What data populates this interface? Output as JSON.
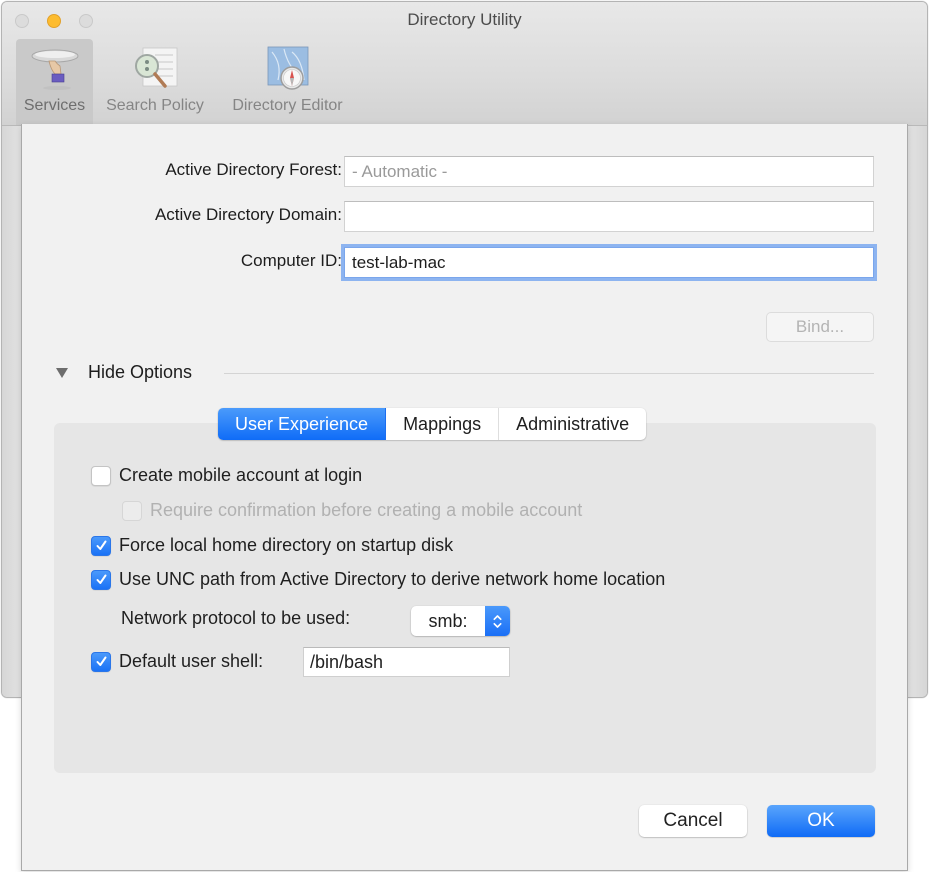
{
  "window": {
    "title": "Directory Utility",
    "toolbar": [
      {
        "label": "Services",
        "icon": "services-icon",
        "selected": true
      },
      {
        "label": "Search Policy",
        "icon": "search-policy-icon",
        "selected": false
      },
      {
        "label": "Directory Editor",
        "icon": "directory-editor-icon",
        "selected": false
      }
    ]
  },
  "sheet": {
    "fields": {
      "forest": {
        "label": "Active Directory Forest:",
        "value": "",
        "placeholder": "- Automatic -"
      },
      "domain": {
        "label": "Active Directory Domain:",
        "value": ""
      },
      "computer_id": {
        "label": "Computer ID:",
        "value": "test-lab-mac"
      }
    },
    "bind_button": "Bind...",
    "disclosure": {
      "label": "Hide Options",
      "expanded": true
    },
    "tabs": [
      {
        "label": "User Experience",
        "active": true
      },
      {
        "label": "Mappings",
        "active": false
      },
      {
        "label": "Administrative",
        "active": false
      }
    ],
    "options": {
      "create_mobile": {
        "label": "Create mobile account at login",
        "checked": false,
        "enabled": true
      },
      "require_confirmation": {
        "label": "Require confirmation before creating a mobile account",
        "checked": false,
        "enabled": false
      },
      "force_local_home": {
        "label": "Force local home directory on startup disk",
        "checked": true,
        "enabled": true
      },
      "use_unc": {
        "label": "Use UNC path from Active Directory to derive network home location",
        "checked": true,
        "enabled": true
      },
      "network_protocol": {
        "label": "Network protocol to be used:",
        "value": "smb:"
      },
      "default_shell": {
        "label": "Default user shell:",
        "checked": true,
        "value": "/bin/bash"
      }
    },
    "buttons": {
      "cancel": "Cancel",
      "ok": "OK"
    }
  },
  "colors": {
    "accent": "#1a72f6",
    "minimize": "#fdbc2f",
    "sheet_bg": "#f1f1f1",
    "tab_box_bg": "#e6e6e6"
  }
}
